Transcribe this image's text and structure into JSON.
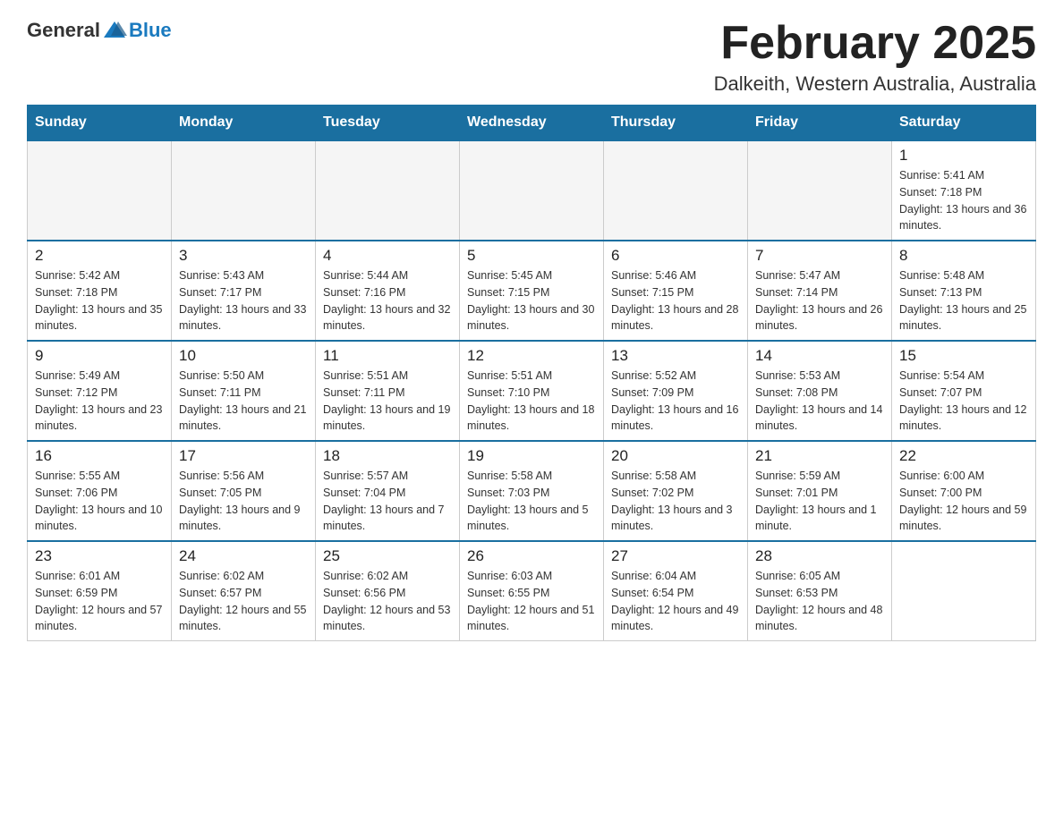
{
  "header": {
    "logo": {
      "general": "General",
      "blue": "Blue"
    },
    "title": "February 2025",
    "location": "Dalkeith, Western Australia, Australia"
  },
  "days_of_week": [
    "Sunday",
    "Monday",
    "Tuesday",
    "Wednesday",
    "Thursday",
    "Friday",
    "Saturday"
  ],
  "weeks": [
    [
      {
        "day": "",
        "info": ""
      },
      {
        "day": "",
        "info": ""
      },
      {
        "day": "",
        "info": ""
      },
      {
        "day": "",
        "info": ""
      },
      {
        "day": "",
        "info": ""
      },
      {
        "day": "",
        "info": ""
      },
      {
        "day": "1",
        "info": "Sunrise: 5:41 AM\nSunset: 7:18 PM\nDaylight: 13 hours and 36 minutes."
      }
    ],
    [
      {
        "day": "2",
        "info": "Sunrise: 5:42 AM\nSunset: 7:18 PM\nDaylight: 13 hours and 35 minutes."
      },
      {
        "day": "3",
        "info": "Sunrise: 5:43 AM\nSunset: 7:17 PM\nDaylight: 13 hours and 33 minutes."
      },
      {
        "day": "4",
        "info": "Sunrise: 5:44 AM\nSunset: 7:16 PM\nDaylight: 13 hours and 32 minutes."
      },
      {
        "day": "5",
        "info": "Sunrise: 5:45 AM\nSunset: 7:15 PM\nDaylight: 13 hours and 30 minutes."
      },
      {
        "day": "6",
        "info": "Sunrise: 5:46 AM\nSunset: 7:15 PM\nDaylight: 13 hours and 28 minutes."
      },
      {
        "day": "7",
        "info": "Sunrise: 5:47 AM\nSunset: 7:14 PM\nDaylight: 13 hours and 26 minutes."
      },
      {
        "day": "8",
        "info": "Sunrise: 5:48 AM\nSunset: 7:13 PM\nDaylight: 13 hours and 25 minutes."
      }
    ],
    [
      {
        "day": "9",
        "info": "Sunrise: 5:49 AM\nSunset: 7:12 PM\nDaylight: 13 hours and 23 minutes."
      },
      {
        "day": "10",
        "info": "Sunrise: 5:50 AM\nSunset: 7:11 PM\nDaylight: 13 hours and 21 minutes."
      },
      {
        "day": "11",
        "info": "Sunrise: 5:51 AM\nSunset: 7:11 PM\nDaylight: 13 hours and 19 minutes."
      },
      {
        "day": "12",
        "info": "Sunrise: 5:51 AM\nSunset: 7:10 PM\nDaylight: 13 hours and 18 minutes."
      },
      {
        "day": "13",
        "info": "Sunrise: 5:52 AM\nSunset: 7:09 PM\nDaylight: 13 hours and 16 minutes."
      },
      {
        "day": "14",
        "info": "Sunrise: 5:53 AM\nSunset: 7:08 PM\nDaylight: 13 hours and 14 minutes."
      },
      {
        "day": "15",
        "info": "Sunrise: 5:54 AM\nSunset: 7:07 PM\nDaylight: 13 hours and 12 minutes."
      }
    ],
    [
      {
        "day": "16",
        "info": "Sunrise: 5:55 AM\nSunset: 7:06 PM\nDaylight: 13 hours and 10 minutes."
      },
      {
        "day": "17",
        "info": "Sunrise: 5:56 AM\nSunset: 7:05 PM\nDaylight: 13 hours and 9 minutes."
      },
      {
        "day": "18",
        "info": "Sunrise: 5:57 AM\nSunset: 7:04 PM\nDaylight: 13 hours and 7 minutes."
      },
      {
        "day": "19",
        "info": "Sunrise: 5:58 AM\nSunset: 7:03 PM\nDaylight: 13 hours and 5 minutes."
      },
      {
        "day": "20",
        "info": "Sunrise: 5:58 AM\nSunset: 7:02 PM\nDaylight: 13 hours and 3 minutes."
      },
      {
        "day": "21",
        "info": "Sunrise: 5:59 AM\nSunset: 7:01 PM\nDaylight: 13 hours and 1 minute."
      },
      {
        "day": "22",
        "info": "Sunrise: 6:00 AM\nSunset: 7:00 PM\nDaylight: 12 hours and 59 minutes."
      }
    ],
    [
      {
        "day": "23",
        "info": "Sunrise: 6:01 AM\nSunset: 6:59 PM\nDaylight: 12 hours and 57 minutes."
      },
      {
        "day": "24",
        "info": "Sunrise: 6:02 AM\nSunset: 6:57 PM\nDaylight: 12 hours and 55 minutes."
      },
      {
        "day": "25",
        "info": "Sunrise: 6:02 AM\nSunset: 6:56 PM\nDaylight: 12 hours and 53 minutes."
      },
      {
        "day": "26",
        "info": "Sunrise: 6:03 AM\nSunset: 6:55 PM\nDaylight: 12 hours and 51 minutes."
      },
      {
        "day": "27",
        "info": "Sunrise: 6:04 AM\nSunset: 6:54 PM\nDaylight: 12 hours and 49 minutes."
      },
      {
        "day": "28",
        "info": "Sunrise: 6:05 AM\nSunset: 6:53 PM\nDaylight: 12 hours and 48 minutes."
      },
      {
        "day": "",
        "info": ""
      }
    ]
  ]
}
